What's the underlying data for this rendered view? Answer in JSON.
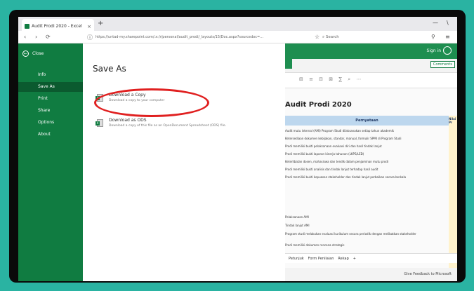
{
  "browser": {
    "tab_title": "Audit Prodi 2020 - Excel",
    "tab_close": "×",
    "new_tab": "+",
    "url": "https://untad-my.sharepoint.com/:x:/r/personal/audit_prodi/_layouts/15/Doc.aspx?sourcedoc=...",
    "search_placeholder": "Search",
    "minimize": "—",
    "close": "\\"
  },
  "backstage": {
    "back_label": "Close",
    "nav_items": [
      "Info",
      "Save As",
      "Print",
      "Share",
      "Options",
      "About"
    ],
    "active_index": 1
  },
  "save_as": {
    "title": "Save As",
    "options": [
      {
        "title": "Download a Copy",
        "desc": "Download a copy to your computer"
      },
      {
        "title": "Download as ODS",
        "desc": "Download a copy of this file as an OpenDocument Spreadsheet (ODS) file."
      }
    ]
  },
  "excel": {
    "user_label": "Sign in",
    "comments_label": "Comments",
    "sheet_heading": "Audit Prodi 2020",
    "col_header": "Pernyataan",
    "side_header": "Nilai Pr",
    "rows": [
      "Audit mutu internal (AMI) Program Studi dilaksanakan setiap tahun akademik",
      "Ketersediaan dokumen kebijakan, standar, manual, formulir SPMI di Program Studi",
      "Prodi memiliki bukti pelaksanaan evaluasi diri dan hasil tindak lanjut",
      "Prodi memiliki bukti laporan kinerja tahunan (LKPS/LED)",
      "Keterlibatan dosen, mahasiswa dan tendik dalam penjaminan mutu prodi",
      "Prodi memiliki bukti analisis dan tindak lanjut terhadap hasil audit",
      "Prodi memiliki bukti kepuasan stakeholder dan tindak lanjut perbaikan secara berkala",
      "",
      "",
      "Pelaksanaan AMI",
      "Tindak lanjut AMI",
      "Program studi melakukan evaluasi kurikulum secara periodik dengan melibatkan stakeholder",
      "Prodi memiliki dokumen rencana strategis"
    ],
    "sheets": [
      "Petunjuk",
      "Form Penilaian",
      "Rekap",
      "+"
    ],
    "status": "Give Feedback to Microsoft"
  }
}
